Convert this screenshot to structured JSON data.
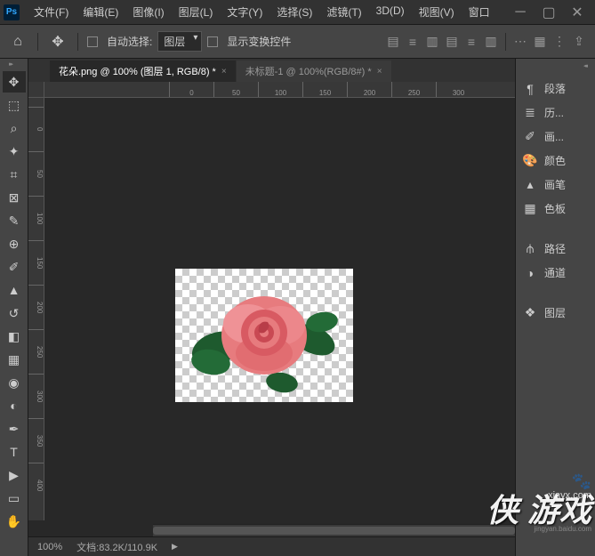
{
  "app": {
    "logo": "Ps"
  },
  "menu": [
    "文件(F)",
    "编辑(E)",
    "图像(I)",
    "图层(L)",
    "文字(Y)",
    "选择(S)",
    "滤镜(T)",
    "3D(D)",
    "视图(V)",
    "窗口"
  ],
  "toolbar": {
    "auto_select_label": "自动选择:",
    "dropdown_value": "图层",
    "show_transform_label": "显示变换控件"
  },
  "tabs": [
    {
      "label": "花朵.png @ 100% (图层 1, RGB/8) *",
      "active": true
    },
    {
      "label": "未标题-1 @ 100%(RGB/8#) *",
      "active": false
    }
  ],
  "ruler_h": [
    "0",
    "50",
    "100",
    "150",
    "200",
    "250",
    "300"
  ],
  "ruler_v": [
    "0",
    "50",
    "100",
    "150",
    "200",
    "250",
    "300",
    "350",
    "400"
  ],
  "status": {
    "zoom": "100%",
    "doc": "文档:83.2K/110.9K"
  },
  "panels": [
    {
      "icon": "paragraph",
      "label": "段落"
    },
    {
      "icon": "history",
      "label": "历..."
    },
    {
      "icon": "brush",
      "label": "画..."
    },
    {
      "icon": "color",
      "label": "颜色"
    },
    {
      "icon": "brushset",
      "label": "画笔"
    },
    {
      "icon": "swatch",
      "label": "色板"
    },
    {
      "gap": true
    },
    {
      "icon": "path",
      "label": "路径"
    },
    {
      "icon": "channel",
      "label": "通道"
    },
    {
      "gap": true
    },
    {
      "icon": "layer",
      "label": "图层"
    }
  ],
  "watermark": {
    "main": "侠 游戏",
    "url": "xiayx.com",
    "sub": "jingyan.baidu.com"
  }
}
